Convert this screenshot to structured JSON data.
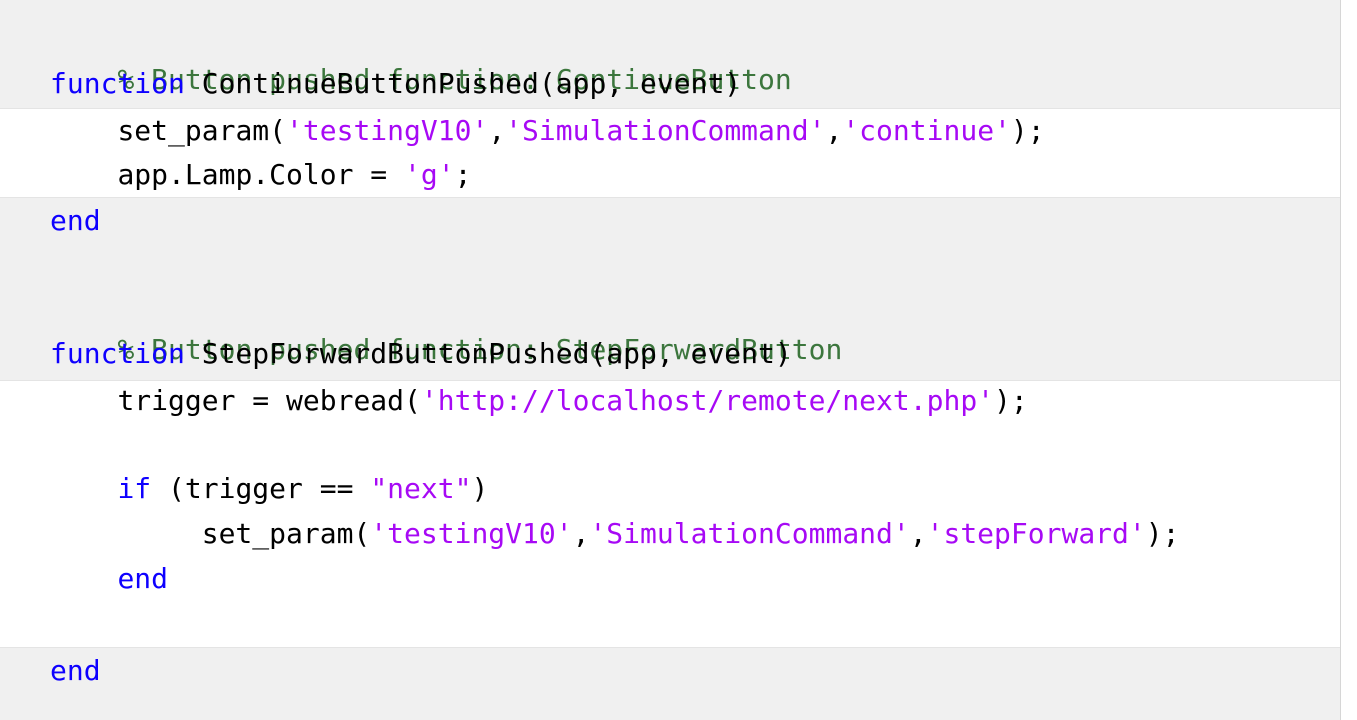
{
  "code": {
    "line1": {
      "comment": "% Button pushed function: ContinueButton"
    },
    "line2": {
      "keyword": "function",
      "rest": " ContinueButtonPushed(app, event)"
    },
    "line3": {
      "indent": "    ",
      "pre": "set_param(",
      "s1": "'testingV10'",
      "c1": ",",
      "s2": "'SimulationCommand'",
      "c2": ",",
      "s3": "'continue'",
      "post": ");"
    },
    "line4": {
      "indent": "    ",
      "pre": "app.Lamp.Color = ",
      "s1": "'g'",
      "post": ";"
    },
    "line5": {
      "keyword": "end"
    },
    "line6": {
      "comment": "% Button pushed function: StepForwardButton"
    },
    "line7": {
      "keyword": "function",
      "rest": " StepForwardButtonPushed(app, event)"
    },
    "line8": {
      "indent": "    ",
      "pre": "trigger = webread(",
      "s1": "'http://localhost/remote/next.php'",
      "post": ");"
    },
    "line9": {
      "indent": "    ",
      "keyword": "if",
      "pre": " (trigger == ",
      "s1": "\"next\"",
      "post": ")"
    },
    "line10": {
      "indent": "         ",
      "pre": "set_param(",
      "s1": "'testingV10'",
      "c1": ",",
      "s2": "'SimulationCommand'",
      "c2": ",",
      "s3": "'stepForward'",
      "post": ");"
    },
    "line11": {
      "indent": "    ",
      "keyword": "end"
    },
    "line12": {
      "keyword": "end"
    }
  },
  "colors": {
    "keyword": "#0e00ff",
    "comment": "#3c763d",
    "string": "#a709f5",
    "band_background": "#f0f0f0"
  }
}
